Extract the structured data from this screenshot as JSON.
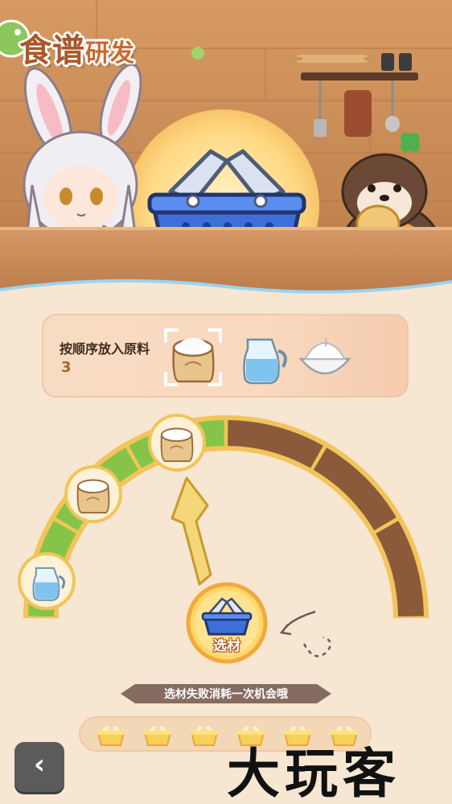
{
  "header": {
    "title_main": "食谱",
    "title_sub": "研发"
  },
  "recipe": {
    "instruction": "按顺序放入原料",
    "remaining_count": "3",
    "sequence_icons": [
      "flour-sack-icon",
      "milk-jug-icon",
      "cream-bowl-icon"
    ],
    "highlighted_index": 0
  },
  "gauge": {
    "segments": [
      "green",
      "green",
      "green",
      "brown",
      "brown",
      "brown"
    ],
    "placed_icons": [
      "milk-jug-icon",
      "flour-sack-icon",
      "flour-sack-icon"
    ],
    "pointer_segment": 2
  },
  "select_button": {
    "label": "选材"
  },
  "hint": {
    "text": "选材失败消耗一次机会哦"
  },
  "attempts": {
    "total": 6,
    "icon": "basket-icon"
  },
  "back_button": {
    "icon": "back-arrow-icon",
    "glyph": "‹"
  },
  "watermark": {
    "text": "大玩客"
  },
  "colors": {
    "green": "#86c449",
    "brown": "#8a5a3b",
    "gold": "#f2c45a",
    "basket_blue": "#3e6fd8",
    "title": "#a9582a"
  }
}
